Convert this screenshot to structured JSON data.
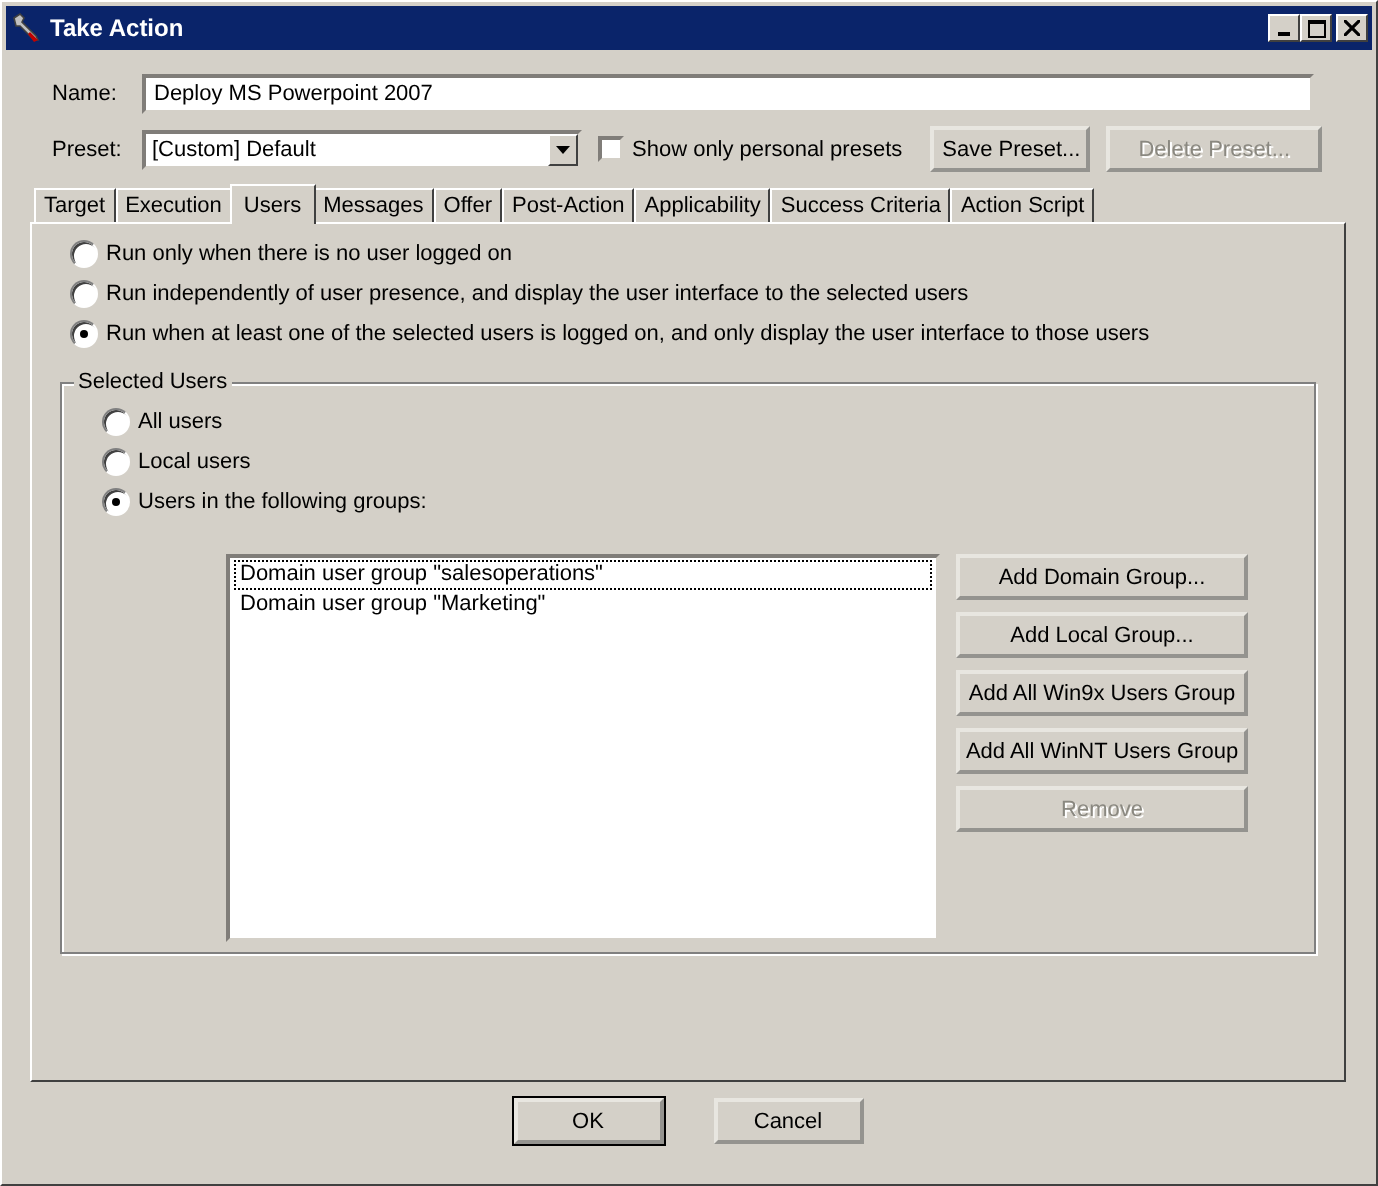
{
  "window": {
    "title": "Take Action"
  },
  "name_field": {
    "label": "Name:",
    "value": "Deploy MS Powerpoint 2007"
  },
  "preset": {
    "label": "Preset:",
    "value": "[Custom] Default",
    "personal_only": {
      "label": "Show only personal presets",
      "checked": false
    },
    "buttons": [
      {
        "label": "Save Preset...",
        "disabled": false
      },
      {
        "label": "Delete Preset...",
        "disabled": true
      }
    ]
  },
  "tabs": [
    {
      "label": "Target",
      "selected": false
    },
    {
      "label": "Execution",
      "selected": false
    },
    {
      "label": "Users",
      "selected": true
    },
    {
      "label": "Messages",
      "selected": false
    },
    {
      "label": "Offer",
      "selected": false
    },
    {
      "label": "Post-Action",
      "selected": false
    },
    {
      "label": "Applicability",
      "selected": false
    },
    {
      "label": "Success Criteria",
      "selected": false
    },
    {
      "label": "Action Script",
      "selected": false
    }
  ],
  "run_options": [
    {
      "label": "Run only when there is no user logged on",
      "selected": false
    },
    {
      "label": "Run independently of user presence, and display the user interface to the selected users",
      "selected": false
    },
    {
      "label": "Run when at least one of the selected users is logged on, and only display the user interface to those users",
      "selected": true
    }
  ],
  "selected_users": {
    "title": "Selected Users",
    "options": [
      {
        "label": "All users",
        "selected": false
      },
      {
        "label": "Local users",
        "selected": false
      },
      {
        "label": "Users in the following groups:",
        "selected": true
      }
    ],
    "groups": [
      {
        "label": "Domain user group \"salesoperations\"",
        "focused": true
      },
      {
        "label": "Domain user group \"Marketing\"",
        "focused": false
      }
    ],
    "buttons": [
      {
        "label": "Add Domain Group...",
        "disabled": false
      },
      {
        "label": "Add Local Group...",
        "disabled": false
      },
      {
        "label": "Add All Win9x Users Group",
        "disabled": false
      },
      {
        "label": "Add All WinNT Users Group",
        "disabled": false
      },
      {
        "label": "Remove",
        "disabled": true
      }
    ]
  },
  "footer_buttons": [
    {
      "label": "OK",
      "disabled": false
    },
    {
      "label": "Cancel",
      "disabled": false
    }
  ]
}
